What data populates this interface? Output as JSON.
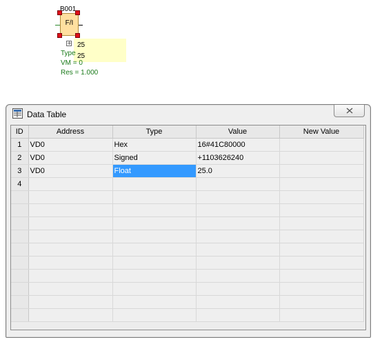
{
  "diagram": {
    "block_name": "B001",
    "block_label": "F/I",
    "value_top": "25",
    "value_second": "25",
    "type_label": "Type",
    "vm_label": "VM = 0",
    "res_label": "Res = 1.000",
    "expand_symbol": "+"
  },
  "window": {
    "title": "Data Table",
    "icon": "data-table-icon",
    "close_icon": "close-icon"
  },
  "table": {
    "headers": [
      "ID",
      "Address",
      "Type",
      "Value",
      "New Value"
    ],
    "rows": [
      {
        "id": "1",
        "address": "VD0",
        "type": "Hex",
        "value": "16#41C80000",
        "new_value": ""
      },
      {
        "id": "2",
        "address": "VD0",
        "type": "Signed",
        "value": "+1103626240",
        "new_value": ""
      },
      {
        "id": "3",
        "address": "VD0",
        "type": "Float",
        "value": "25.0",
        "new_value": ""
      },
      {
        "id": "4",
        "address": "",
        "type": "",
        "value": "",
        "new_value": ""
      }
    ],
    "selected_cell": "row 3, Type",
    "empty_row_count": 10
  },
  "colors": {
    "selection": "#3399ff",
    "block_fill": "#ffe0a0",
    "handle": "#e0101a",
    "tooltip": "#ffffc8",
    "label_green": "#1a7a1a"
  }
}
